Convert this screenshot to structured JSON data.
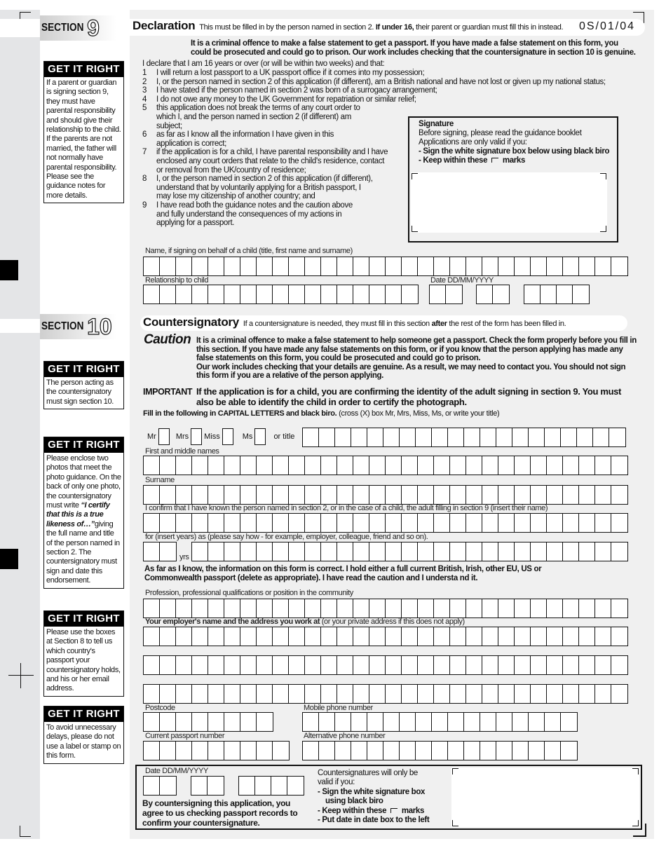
{
  "form_ref": "0S/01/04",
  "section9": {
    "label_word": "SECTION",
    "label_num": "9",
    "title": "Declaration",
    "subtitle_pre": "This must be filled in by the person named in section 2.",
    "subtitle_bold": "If under 16,",
    "subtitle_post": "their parent or guardian must fill this in instead.",
    "warning_line1": "It is a criminal offence to make a false statement to get a passport. If you have made a false statement on this form, you",
    "warning_line2": "could be prosecuted and could go to prison. Our work includes checking that the countersignature in section 10 is genuine.",
    "intro": "I declare that I am 16 years or over (or will be within two weeks) and that:",
    "items": [
      {
        "num": "1",
        "text": "I will return a lost passport to a UK passport office if it comes into my possession;"
      },
      {
        "num": "2",
        "text": "I, or the person named in section 2 of this application (if different), am a British national and have not lost or given up my national status;"
      },
      {
        "num": "3",
        "text": "I have stated if the person named in section 2 was born of a surrogacy arrangement;"
      },
      {
        "num": "4",
        "text": "I do not owe any money to the UK Government for repatriation or similar relief;"
      },
      {
        "num": "5",
        "text": "this application does not break the terms of any court order to which I, and the person named in section 2 (if different) am subject;"
      },
      {
        "num": "6",
        "text": "as far as I know all the information I have given in this application is correct;"
      },
      {
        "num": "7",
        "text": "if the application is for a child, I have parental responsibility and I have enclosed any court orders that relate to the child's residence, contact or removal from the UK/country of residence;"
      },
      {
        "num": "8",
        "text": "I, or the person named in section 2 of this application (if different), understand that by voluntarily applying for a British passport, I may lose my citizenship of another country; and"
      },
      {
        "num": "9",
        "text": "I have read both the guidance notes and the caution above and fully understand the consequences of my actions in applying for a passport."
      }
    ],
    "signature": {
      "title": "Signature",
      "line1": "Before signing, please read the guidance booklet",
      "line2": "Applications are only valid if you:",
      "bullet1": "-  Sign the white signature box below using black biro",
      "bullet2_pre": "-  Keep within these",
      "bullet2_post": "marks"
    },
    "child_name_label": "Name, if signing on behalf of a child (title, first name and surname)",
    "relationship_label": "Relationship to child",
    "date_label": "Date DD/MM/YYYY",
    "get_it_right": {
      "heading": "GET IT RIGHT",
      "text": "If a parent or guardian is signing section 9, they must have parental responsibility and should give their relationship to the child. If the parents are not married, the father will not normally have parental responsibility. Please see the guidance notes for more details."
    }
  },
  "section10": {
    "label_word": "SECTION",
    "label_num": "10",
    "title": "Countersignatory",
    "subtitle_pre": "If a countersignature is needed, they must fill in this section",
    "subtitle_bold": "after",
    "subtitle_post": "the rest of the form has been filled in.",
    "caution_label": "Caution",
    "caution_text": "It is a criminal offence to make a false statement to help someone get a passport. Check the form properly before you fill in this section. If you have made any false statements on this form, or if you know that the person applying has made any false statements on this form, you could be prosecuted and could go to prison.",
    "caution_text2": "Our work includes checking that your details are genuine. As a result, we may need to contact you. You should not sign this form if you are a relative of the person applying.",
    "important_label": "IMPORTANT",
    "important_text": "If the application is for a child, you are confirming the identity of the adult signing in section 9. You must also be able to identify the child in order to certify the photograph.",
    "fill_bold": "Fill in the following in CAPITAL LETTERS and black biro.",
    "fill_note": "(cross (X) box Mr, Mrs, Miss, Ms, or write your title)",
    "titles": [
      "Mr",
      "Mrs",
      "Miss",
      "Ms"
    ],
    "or_title": "or title",
    "first_names_label": "First and middle names",
    "surname_label": "Surname",
    "confirm_label": "I confirm that I have known the person named in section 2, or in the case of a child, the adult filling in section 9 (insert their name)",
    "years_label": "for (insert years) as (please say how - for example, employer, colleague, friend and so on).",
    "yrs": "yrs",
    "statement_line1": "As far as I know, the information on this form is correct. I hold either a full current British, Irish, other EU, US or",
    "statement_line2": "Commonwealth passport (delete as appropriate). I have read the caution and I understa nd it.",
    "profession_label": "Profession, professional qualifications or position in the community",
    "employer_label_bold": "Your employer's name and the address you work at",
    "employer_label_note": "(or your private address if this does not apply)",
    "postcode_label": "Postcode",
    "mobile_label": "Mobile phone number",
    "passport_label": "Current passport number",
    "alt_phone_label": "Alternative phone number",
    "date_label": "Date DD/MM/YYYY",
    "agree_text": "By countersigning this application, you agree to us checking passport records to confirm your countersignature.",
    "valid_line1": "Countersignatures will only be",
    "valid_line2": "valid if you:",
    "valid_b1a": "-  Sign the white signature box",
    "valid_b1b": "using black biro",
    "valid_b2_pre": "-  Keep within these",
    "valid_b2_post": "marks",
    "valid_b3": "-  Put date in date box to the left",
    "get_it_right": [
      {
        "heading": "GET IT RIGHT",
        "text": "The person acting as the countersignatory must sign section 10."
      },
      {
        "heading": "GET IT RIGHT",
        "text_pre": "Please enclose two photos that meet the photo guidance. On the back of only one photo, the countersignatory must write ",
        "quote": "“I certify that this is a true likeness of…”",
        "text_post": "giving the full name and title of the person named in section 2. The countersignatory must sign and date this endorsement."
      },
      {
        "heading": "GET IT RIGHT",
        "text": "Please use the boxes at Section 8 to tell us which country's passport your countersignatory holds, and his or her email address."
      },
      {
        "heading": "GET IT RIGHT",
        "text": "To avoid unnecessary delays, please do not use a label or stamp on this form."
      }
    ]
  }
}
